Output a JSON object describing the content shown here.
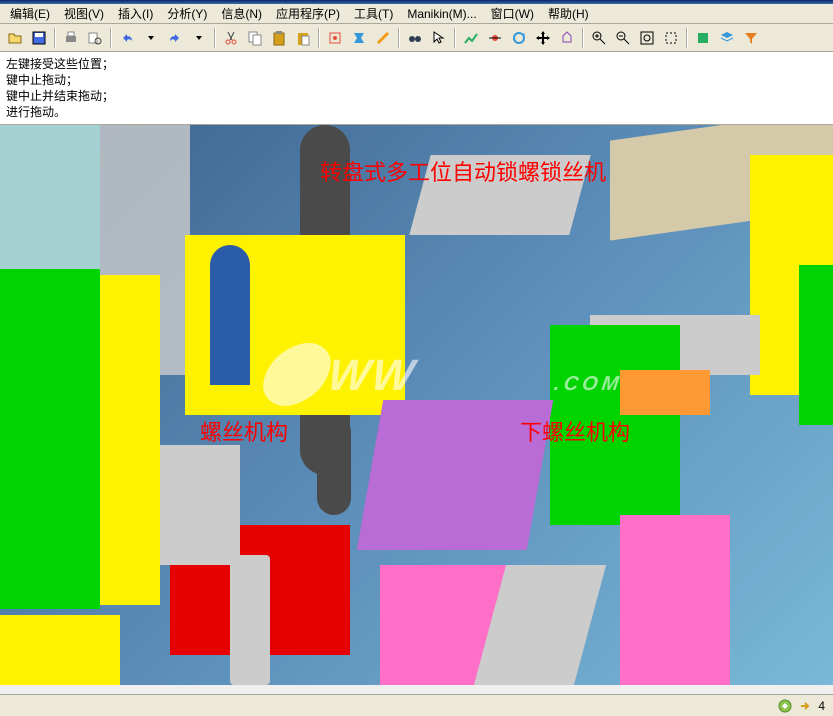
{
  "menubar": {
    "items": [
      {
        "label": "编辑(E)"
      },
      {
        "label": "视图(V)"
      },
      {
        "label": "插入(I)"
      },
      {
        "label": "分析(Y)"
      },
      {
        "label": "信息(N)"
      },
      {
        "label": "应用程序(P)"
      },
      {
        "label": "工具(T)"
      },
      {
        "label": "Manikin(M)..."
      },
      {
        "label": "窗口(W)"
      },
      {
        "label": "帮助(H)"
      }
    ]
  },
  "messages": {
    "line1": "左键接受这些位置；",
    "line2": "键中止拖动；",
    "line3": "键中止并结束拖动；",
    "line4": "进行拖动。"
  },
  "annotations": {
    "title": "转盘式多工位自动锁螺锁丝机",
    "left": "螺丝机构",
    "right": "下螺丝机构"
  },
  "watermark": {
    "url": "WW",
    "suffix": ".COM"
  },
  "statusbar": {
    "count": "4"
  },
  "icons": {
    "open": "open-icon",
    "save": "save-icon",
    "print": "print-icon",
    "undo": "undo-icon",
    "redo": "redo-icon",
    "cut": "cut-icon",
    "copy": "copy-icon",
    "paste": "paste-icon"
  }
}
